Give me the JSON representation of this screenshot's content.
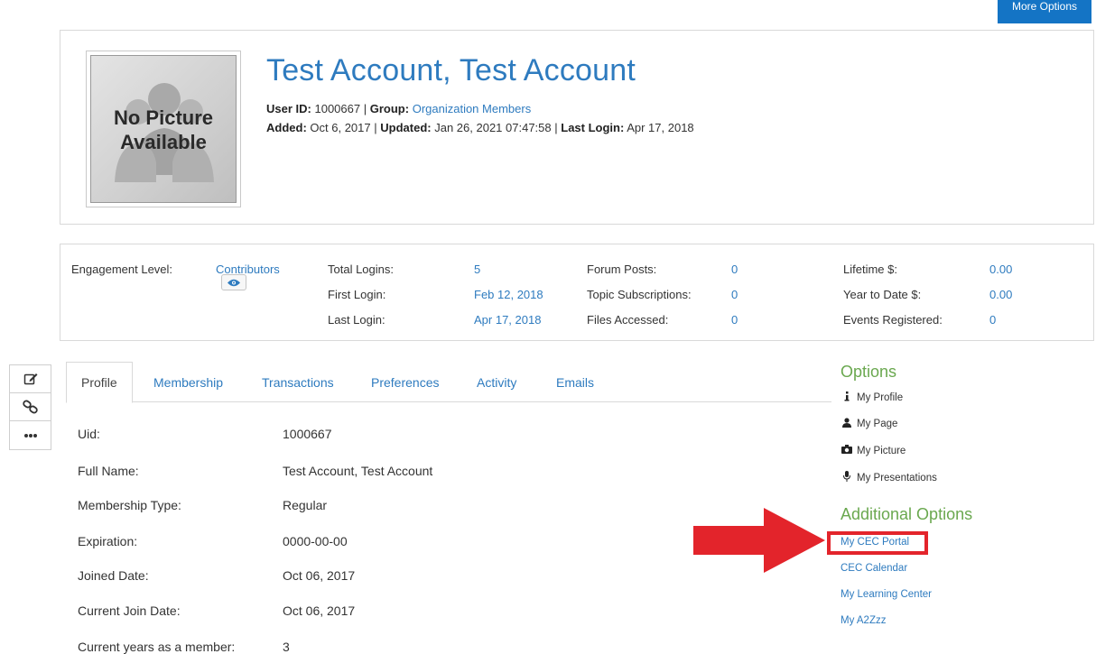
{
  "top": {
    "more_options_label": "More Options"
  },
  "header": {
    "avatar_line1": "No Picture",
    "avatar_line2": "Available",
    "name": "Test Account, Test Account",
    "user_id_label": "User ID:",
    "user_id": "1000667",
    "group_label": "Group:",
    "group": "Organization Members",
    "added_label": "Added:",
    "added": "Oct 6, 2017",
    "updated_label": "Updated:",
    "updated": "Jan 26, 2021 07:47:58",
    "last_login_label": "Last Login:",
    "last_login": "Apr 17, 2018",
    "separator": "|"
  },
  "stats": {
    "engagement_label": "Engagement Level:",
    "engagement_value": "Contributors",
    "total_logins_label": "Total Logins:",
    "total_logins": "5",
    "first_login_label": "First Login:",
    "first_login": "Feb 12, 2018",
    "last_login_label": "Last Login:",
    "last_login": "Apr 17, 2018",
    "forum_posts_label": "Forum Posts:",
    "forum_posts": "0",
    "topic_subs_label": "Topic Subscriptions:",
    "topic_subs": "0",
    "files_accessed_label": "Files Accessed:",
    "files_accessed": "0",
    "lifetime_label": "Lifetime $:",
    "lifetime": "0.00",
    "ytd_label": "Year to Date $:",
    "ytd": "0.00",
    "events_label": "Events Registered:",
    "events": "0"
  },
  "toolbar": {
    "icons": [
      "edit-icon",
      "link-icon",
      "more-icon"
    ]
  },
  "tabs": [
    {
      "label": "Profile",
      "active": true
    },
    {
      "label": "Membership"
    },
    {
      "label": "Transactions"
    },
    {
      "label": "Preferences"
    },
    {
      "label": "Activity"
    },
    {
      "label": "Emails"
    }
  ],
  "profile": {
    "uid_label": "Uid:",
    "uid": "1000667",
    "full_name_label": "Full Name:",
    "full_name": "Test Account, Test Account",
    "membership_type_label": "Membership Type:",
    "membership_type": "Regular",
    "expiration_label": "Expiration:",
    "expiration": "0000-00-00",
    "joined_label": "Joined Date:",
    "joined": "Oct 06, 2017",
    "current_join_label": "Current Join Date:",
    "current_join": "Oct 06, 2017",
    "years_label": "Current years as a member:",
    "years": "3"
  },
  "options": {
    "heading": "Options",
    "items": [
      {
        "icon": "info-icon",
        "label": "My Profile"
      },
      {
        "icon": "user-icon",
        "label": "My Page"
      },
      {
        "icon": "camera-icon",
        "label": "My Picture"
      },
      {
        "icon": "microphone-icon",
        "label": "My Presentations"
      }
    ]
  },
  "additional": {
    "heading": "Additional Options",
    "items": [
      "My CEC Portal",
      "CEC Calendar",
      "My Learning Center",
      "My A2Zzz"
    ]
  },
  "colors": {
    "accent": "#2e7bbf",
    "heading_green": "#6aa84f",
    "highlight_red": "#e3242b",
    "button_blue": "#1474c5"
  }
}
